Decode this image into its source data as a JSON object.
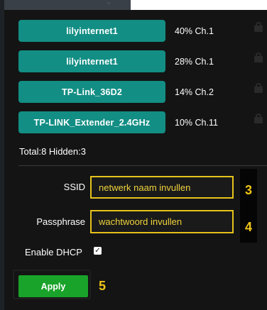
{
  "networks": [
    {
      "ssid": "lilyinternet1",
      "signal": "40%",
      "channel": "Ch.1"
    },
    {
      "ssid": "lilyinternet1",
      "signal": "28%",
      "channel": "Ch.1"
    },
    {
      "ssid": "TP-Link_36D2",
      "signal": "14%",
      "channel": "Ch.2"
    },
    {
      "ssid": "TP-LINK_Extender_2.4GHz",
      "signal": "10%",
      "channel": "Ch.11"
    }
  ],
  "summary": {
    "text": "Total:8 Hidden:3"
  },
  "form": {
    "ssid_label": "SSID",
    "ssid_value": "netwerk naam invullen",
    "ssid_marker": "3",
    "pass_label": "Passphrase",
    "pass_value": "wachtwoord invullen",
    "pass_marker": "4",
    "dhcp_label": "Enable DHCP",
    "dhcp_checked": true,
    "apply_label": "Apply",
    "apply_marker": "5"
  },
  "colors": {
    "network_button": "#138e84",
    "apply_button": "#1aa32a",
    "annotation": "#e6c21a",
    "panel_bg": "#141414"
  },
  "icons": {
    "lock": "lock-icon",
    "check": "check-icon"
  }
}
